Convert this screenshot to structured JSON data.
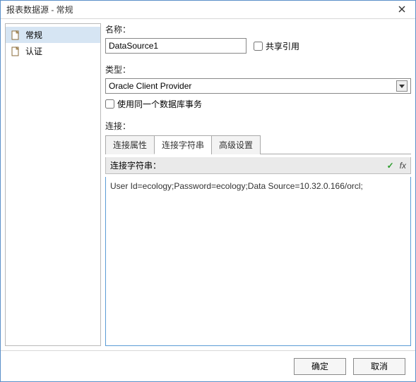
{
  "window": {
    "title": "报表数据源 - 常规"
  },
  "sidebar": {
    "items": [
      {
        "label": "常规"
      },
      {
        "label": "认证"
      }
    ]
  },
  "form": {
    "name_label": "名称：",
    "name_value": "DataSource1",
    "share_label": "共享引用",
    "type_label": "类型：",
    "type_value": "Oracle Client Provider",
    "same_db_label": "使用同一个数据库事务",
    "connection_label": "连接："
  },
  "tabs": [
    {
      "label": "连接属性"
    },
    {
      "label": "连接字符串"
    },
    {
      "label": "高级设置"
    }
  ],
  "conn": {
    "header_label": "连接字符串：",
    "fx_label": "fx",
    "value": "User Id=ecology;Password=ecology;Data Source=10.32.0.166/orcl;"
  },
  "footer": {
    "ok": "确定",
    "cancel": "取消"
  }
}
